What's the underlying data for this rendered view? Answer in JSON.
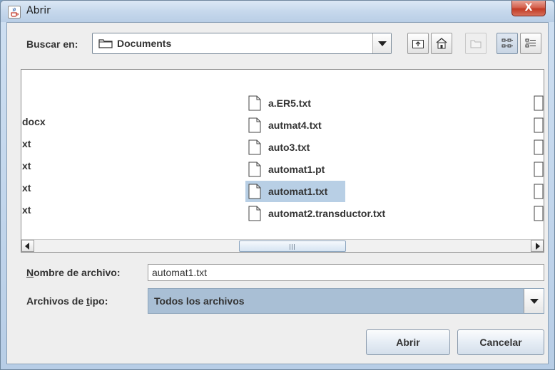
{
  "window": {
    "title": "Abrir",
    "close_label": "X"
  },
  "lookin": {
    "label": "Buscar en:",
    "value": "Documents"
  },
  "toolbar": {
    "buttons": [
      {
        "name": "up-folder-button",
        "icon": "up-folder-icon"
      },
      {
        "name": "home-button",
        "icon": "home-icon"
      },
      {
        "name": "new-folder-button",
        "icon": "new-folder-icon",
        "disabled": true
      },
      {
        "name": "list-view-button",
        "icon": "list-view-icon",
        "pressed": true
      },
      {
        "name": "details-view-button",
        "icon": "details-view-icon"
      }
    ]
  },
  "filelist": {
    "column1": [
      "docx",
      "xt",
      "xt",
      "xt",
      "xt"
    ],
    "column2": [
      "a.ER5.txt",
      "autmat4.txt",
      "auto3.txt",
      "automat1.pt",
      "automat1.txt",
      "automat2.transductor.txt"
    ],
    "selected": "automat1.txt"
  },
  "filename": {
    "label_prefix": "N",
    "label_rest": "ombre de archivo:",
    "value": "automat1.txt"
  },
  "filetype": {
    "label_prefix": "Archivos de ",
    "label_u": "t",
    "label_rest": "ipo:",
    "value": "Todos los archivos"
  },
  "buttons": {
    "open": "Abrir",
    "cancel": "Cancelar"
  },
  "colors": {
    "selection": "#b8cfe5",
    "close_red": "#c23b25"
  }
}
